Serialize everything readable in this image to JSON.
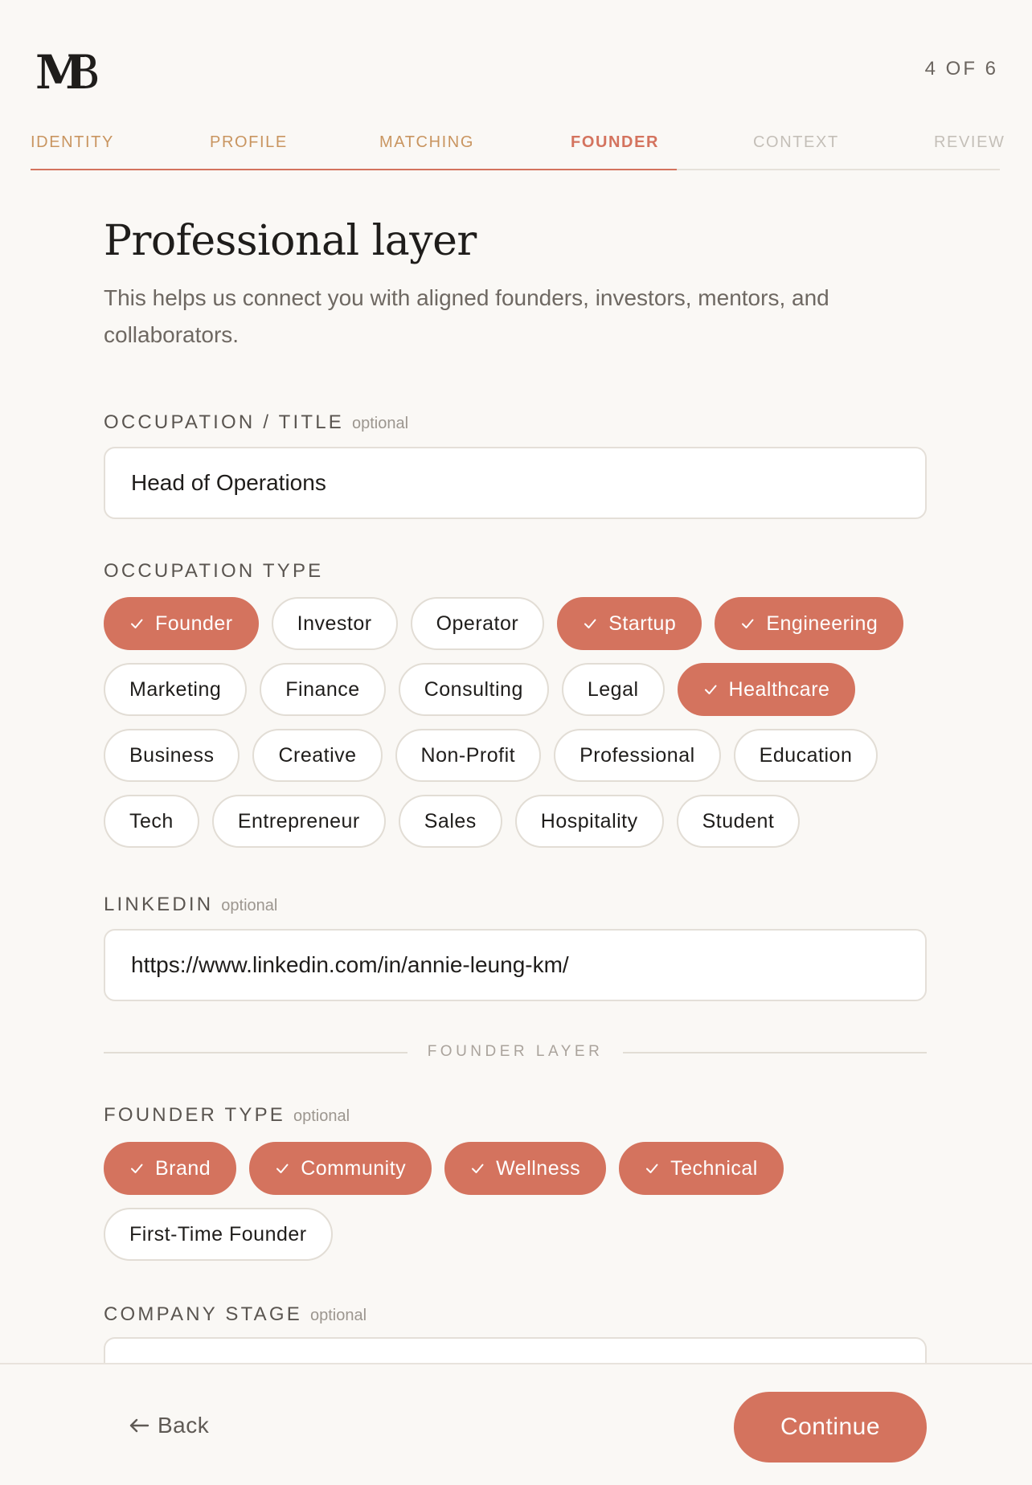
{
  "header": {
    "step_count": "4 OF 6"
  },
  "steps": [
    {
      "label": "IDENTITY",
      "state": "done"
    },
    {
      "label": "PROFILE",
      "state": "done"
    },
    {
      "label": "MATCHING",
      "state": "done"
    },
    {
      "label": "FOUNDER",
      "state": "active"
    },
    {
      "label": "CONTEXT",
      "state": "future"
    },
    {
      "label": "REVIEW",
      "state": "future"
    }
  ],
  "main": {
    "title": "Professional layer",
    "subtitle": "This helps us connect you with aligned founders, investors, mentors, and collaborators."
  },
  "occupation_title": {
    "label": "OCCUPATION / TITLE",
    "optional": "optional",
    "value": "Head of Operations"
  },
  "occupation_type": {
    "label": "OCCUPATION TYPE",
    "options": [
      {
        "label": "Founder",
        "selected": true
      },
      {
        "label": "Investor",
        "selected": false
      },
      {
        "label": "Operator",
        "selected": false
      },
      {
        "label": "Startup",
        "selected": true
      },
      {
        "label": "Engineering",
        "selected": true
      },
      {
        "label": "Marketing",
        "selected": false
      },
      {
        "label": "Finance",
        "selected": false
      },
      {
        "label": "Consulting",
        "selected": false
      },
      {
        "label": "Legal",
        "selected": false
      },
      {
        "label": "Healthcare",
        "selected": true
      },
      {
        "label": "Business",
        "selected": false
      },
      {
        "label": "Creative",
        "selected": false
      },
      {
        "label": "Non-Profit",
        "selected": false
      },
      {
        "label": "Professional",
        "selected": false
      },
      {
        "label": "Education",
        "selected": false
      },
      {
        "label": "Tech",
        "selected": false
      },
      {
        "label": "Entrepreneur",
        "selected": false
      },
      {
        "label": "Sales",
        "selected": false
      },
      {
        "label": "Hospitality",
        "selected": false
      },
      {
        "label": "Student",
        "selected": false
      }
    ]
  },
  "linkedin": {
    "label": "LINKEDIN",
    "optional": "optional",
    "value": "https://www.linkedin.com/in/annie-leung-km/"
  },
  "divider": {
    "label": "FOUNDER LAYER"
  },
  "founder_type": {
    "label": "FOUNDER TYPE",
    "optional": "optional",
    "options": [
      {
        "label": "Brand",
        "selected": true
      },
      {
        "label": "Community",
        "selected": true
      },
      {
        "label": "Wellness",
        "selected": true
      },
      {
        "label": "Technical",
        "selected": true
      },
      {
        "label": "First-Time Founder",
        "selected": false
      }
    ]
  },
  "company_stage": {
    "label": "COMPANY STAGE",
    "optional": "optional"
  },
  "footer": {
    "back_label": "Back",
    "continue_label": "Continue"
  },
  "colors": {
    "accent": "#d4735e",
    "done_step": "#c99560",
    "background": "#faf8f5"
  },
  "icons": {
    "logo": "wb-monogram-logo",
    "chip_check": "check-icon",
    "back": "arrow-left-icon"
  }
}
